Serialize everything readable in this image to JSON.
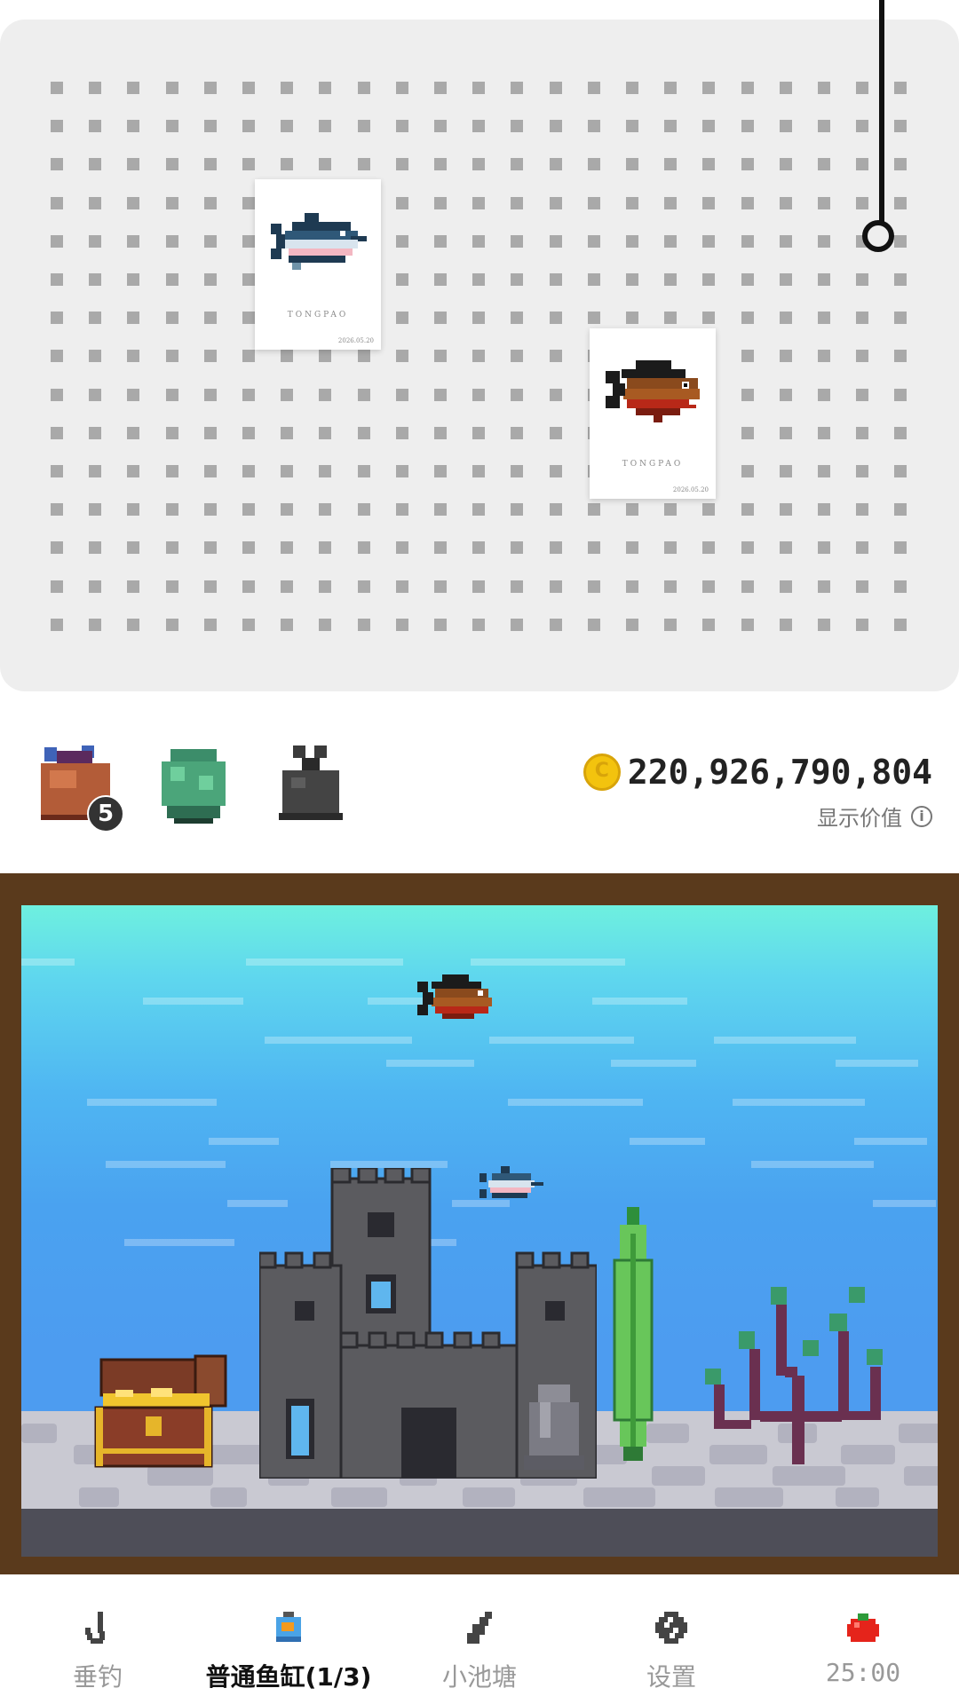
{
  "pegboard": {
    "polaroids": [
      {
        "brand": "TONGPAO",
        "date": "2026.05.20",
        "fish": "swordfish"
      },
      {
        "brand": "TONGPAO",
        "date": "2026.05.20",
        "fish": "piranha"
      }
    ]
  },
  "items": [
    {
      "name": "bait-bag",
      "count": "5"
    },
    {
      "name": "seaweed",
      "count": ""
    },
    {
      "name": "stone-bag",
      "count": ""
    }
  ],
  "wallet": {
    "coins": "220,926,790,804",
    "show_value_label": "显示价值"
  },
  "aquarium": {
    "fish": [
      "piranha",
      "swordfish"
    ],
    "decor": [
      "castle",
      "treasure-chest",
      "rock",
      "cactus-plant",
      "coral"
    ]
  },
  "nav": {
    "items": [
      {
        "label": "垂钓",
        "icon": "hook-icon",
        "active": false
      },
      {
        "label": "普通鱼缸(1/3)",
        "icon": "fishbowl-icon",
        "active": true
      },
      {
        "label": "小池塘",
        "icon": "bottle-icon",
        "active": false
      },
      {
        "label": "设置",
        "icon": "settings-icon",
        "active": false
      },
      {
        "label": "25:00",
        "icon": "tomato-icon",
        "active": false
      }
    ]
  },
  "colors": {
    "pegboard": "#eeeeee",
    "peg": "#a9a9a9",
    "tank_frame": "#5a3a1c",
    "water_top": "#6ef0df",
    "water_bottom": "#4d9cf0"
  }
}
